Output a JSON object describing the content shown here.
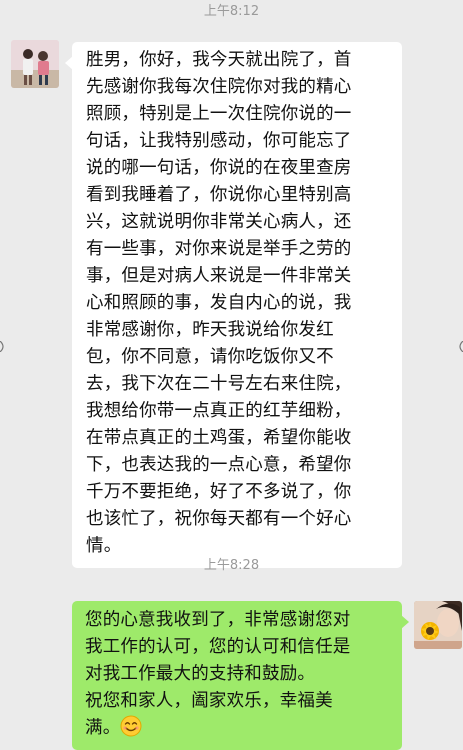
{
  "messages": [
    {
      "timestamp": "上午8:12",
      "sender": "contact",
      "lines": [
        "胜男，你好，我今天就出院了，首",
        "先感谢你我每次住院你对我的精心",
        "照顾，特别是上一次住院你说的一",
        "句话，让我特别感动，你可能忘了",
        "说的哪一句话，你说的在夜里查房",
        "看到我睡着了，你说你心里特别高",
        "兴，这就说明你非常关心病人，还",
        "有一些事，对你来说是举手之劳的",
        "事，但是对病人来说是一件非常关",
        "心和照顾的事，发自内心的说，我",
        "非常感谢你，昨天我说给你发红",
        "包，你不同意，请你吃饭你又不",
        "去，我下次在二十号左右来住院，",
        "我想给你带一点真正的红芋细粉，",
        "在带点真正的土鸡蛋，希望你能收",
        "下，也表达我的一点心意，希望你",
        "千万不要拒绝，好了不多说了，你",
        "也该忙了，祝你每天都有一个好心",
        "情。"
      ]
    },
    {
      "timestamp": "上午8:28",
      "sender": "me",
      "lines": [
        "您的心意我收到了，非常感谢您对",
        "我工作的认可，您的认可和信任是",
        "对我工作最大的支持和鼓励。",
        "祝您和家人，阖家欢乐，幸福美",
        "满。"
      ],
      "trailing_emoji": "smile-emoji-icon"
    }
  ],
  "colors": {
    "background": "#ebebeb",
    "incoming_bubble": "#ffffff",
    "outgoing_bubble": "#9eea6a",
    "timestamp_text": "#9a9a9a"
  }
}
